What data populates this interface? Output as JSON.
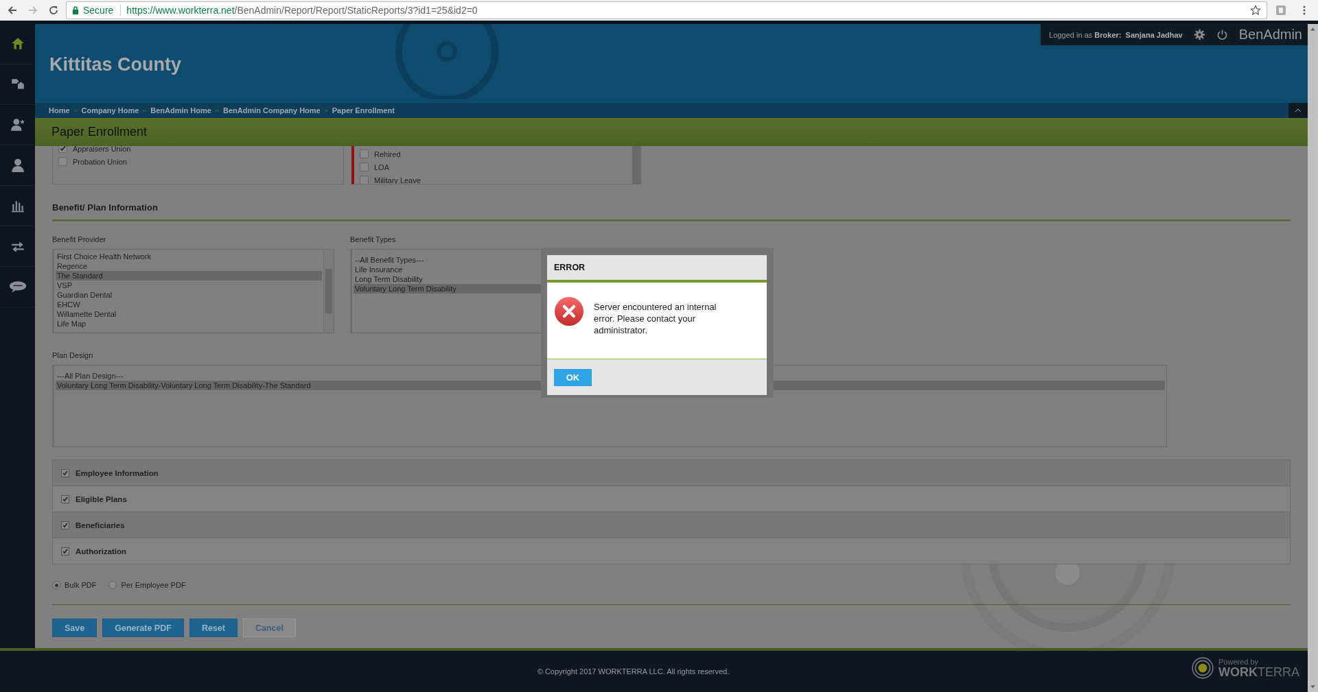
{
  "browser": {
    "secure_label": "Secure",
    "url_host": "https://www.workterra.net",
    "url_path": "/BenAdmin/Report/Report/StaticReports/3?id1=25&id2=0"
  },
  "sidebar": {
    "items": [
      {
        "kind": "home",
        "selected": true
      },
      {
        "kind": "puzzle",
        "selected": false
      },
      {
        "kind": "person-star",
        "selected": false
      },
      {
        "kind": "person",
        "selected": false
      },
      {
        "kind": "chart",
        "selected": false
      },
      {
        "kind": "arrows",
        "selected": false
      },
      {
        "kind": "chat",
        "selected": false
      }
    ]
  },
  "header": {
    "company": "Kittitas County",
    "logged_in": "Logged in as **Broker:  Sanjana Jadhav**",
    "app_name": "BenAdmin"
  },
  "breadcrumbs": [
    "Home",
    "Company Home",
    "BenAdmin Home",
    "BenAdmin Company Home",
    "Paper Enrollment"
  ],
  "page_title": "Paper Enrollment",
  "unions": [
    {
      "label": "Appraisers Union",
      "checked": true
    },
    {
      "label": "Probation Union",
      "checked": false
    }
  ],
  "statuses": [
    {
      "label": "Rehired",
      "checked": false
    },
    {
      "label": "LOA",
      "checked": false
    },
    {
      "label": "Military Leave",
      "checked": false
    }
  ],
  "section_title": "Benefit/ Plan Information",
  "benefit_provider": {
    "label": "Benefit Provider",
    "options": [
      {
        "label": "First Choice Health Network",
        "selected": false
      },
      {
        "label": "Regence",
        "selected": false
      },
      {
        "label": "The Standard",
        "selected": true
      },
      {
        "label": "VSP",
        "selected": false
      },
      {
        "label": "Guardian Dental",
        "selected": false
      },
      {
        "label": "EHCW",
        "selected": false
      },
      {
        "label": "Willamette Dental",
        "selected": false
      },
      {
        "label": "Life Map",
        "selected": false
      }
    ]
  },
  "benefit_types": {
    "label": "Benefit Types",
    "options": [
      {
        "label": "--All Benefit Types---",
        "selected": false
      },
      {
        "label": "Life Insurance",
        "selected": false
      },
      {
        "label": "Long Term Disability",
        "selected": false
      },
      {
        "label": "Voluntary Long Term Disability",
        "selected": true
      }
    ]
  },
  "plan_design": {
    "label": "Plan Design",
    "options": [
      {
        "label": "---All Plan Design---",
        "selected": false
      },
      {
        "label": "Voluntary Long Term Disability-Voluntary Long Term Disability-The Standard",
        "selected": true
      }
    ]
  },
  "sections": [
    {
      "label": "Employee Information",
      "checked": true
    },
    {
      "label": "Eligible Plans",
      "checked": true
    },
    {
      "label": "Beneficiaries",
      "checked": true
    },
    {
      "label": "Authorization",
      "checked": true
    }
  ],
  "pdf_options": [
    {
      "label": "Bulk PDF",
      "selected": true
    },
    {
      "label": "Per Employee PDF",
      "selected": false
    }
  ],
  "buttons": [
    {
      "label": "Save",
      "kind": "primary"
    },
    {
      "label": "Generate PDF",
      "kind": "primary"
    },
    {
      "label": "Reset",
      "kind": "primary"
    },
    {
      "label": "Cancel",
      "kind": "secondary"
    }
  ],
  "footer": {
    "copyright": "© Copyright 2017 WORKTERRA LLC. All rights reserved.",
    "powered_by": "Powered by",
    "brand": "**WORK**TERRA"
  },
  "dialog": {
    "title": "ERROR",
    "message": "Server encountered an internal error. Please contact your administrator.",
    "button": "OK"
  }
}
